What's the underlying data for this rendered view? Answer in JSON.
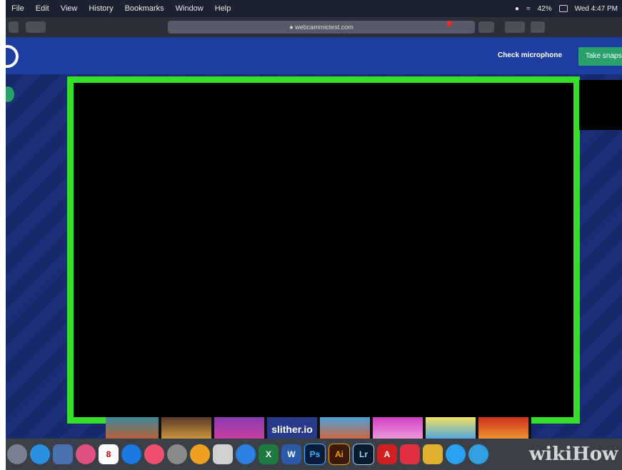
{
  "menubar": {
    "items": [
      "File",
      "Edit",
      "View",
      "History",
      "Bookmarks",
      "Window",
      "Help"
    ],
    "battery": "42%",
    "clock": "Wed 4:47 PM"
  },
  "browser": {
    "url": "webcammictest.com"
  },
  "site": {
    "check_microphone_label": "Check microphone",
    "take_snapshot_label": "Take snapshot"
  },
  "ads": {
    "slither_label": "slither.io"
  },
  "dock": {
    "word_label": "W",
    "excel_label": "X",
    "photoshop_label": "Ps",
    "illustrator_label": "Ai",
    "lightroom_label": "Lr",
    "acrobat_label": "A",
    "calendar_day": "8"
  },
  "watermark": {
    "text": "wikiHow"
  },
  "colors": {
    "webcam_border": "#36e02a",
    "header": "#1e3da0",
    "snapshot_button": "#2aa06a"
  }
}
